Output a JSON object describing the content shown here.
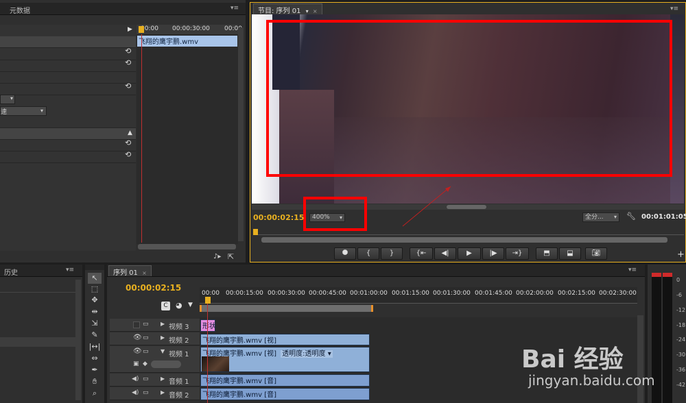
{
  "meta_panel": {
    "tab": "元数据",
    "ruler_ticks": [
      "00:00",
      "00:00:30:00",
      "00:00"
    ],
    "clip_name": "飞翔的鹰宇鹏.wmv",
    "dropdown_partial": "速"
  },
  "program_monitor": {
    "tab": "节目: 序列 01",
    "timecode": "00:00:02:15",
    "zoom": "400%",
    "fit_select": "全分...",
    "duration": "00:01:01:05"
  },
  "history_panel": {
    "tab": "历史"
  },
  "timeline": {
    "tab": "序列 01",
    "timecode": "00:00:02:15",
    "ruler": [
      "00:00",
      "00:00:15:00",
      "00:00:30:00",
      "00:00:45:00",
      "00:01:00:00",
      "00:01:15:00",
      "00:01:30:00",
      "00:01:45:00",
      "00:02:00:00",
      "00:02:15:00",
      "00:02:30:00"
    ],
    "tracks": [
      {
        "name": "视频 3"
      },
      {
        "name": "视频 2"
      },
      {
        "name": "视频 1"
      },
      {
        "name": "音频 1"
      },
      {
        "name": "音频 2"
      }
    ],
    "title_clip": "形状",
    "v2_clip": "飞翔的鹰宇鹏.wmv [视]",
    "v1_clip": "飞翔的鹰宇鹏.wmv [视]",
    "v1_opacity": "透明度:透明度",
    "a1_clip": "飞翔的鹰宇鹏.wmv [音]",
    "a2_clip": "飞翔的鹰宇鹏.wmv [音]"
  },
  "audio_meter": {
    "labels": [
      "0",
      "-6",
      "-12",
      "-18",
      "-24",
      "-30",
      "-36",
      "-42"
    ]
  },
  "watermark": {
    "brand": "Bai 经验",
    "url": "jingyan.baidu.com"
  },
  "colors": {
    "timecode": "#e8b020",
    "highlight": "#ff0000",
    "clip": "#8fb0d8",
    "title_clip": "#e58ee0"
  }
}
